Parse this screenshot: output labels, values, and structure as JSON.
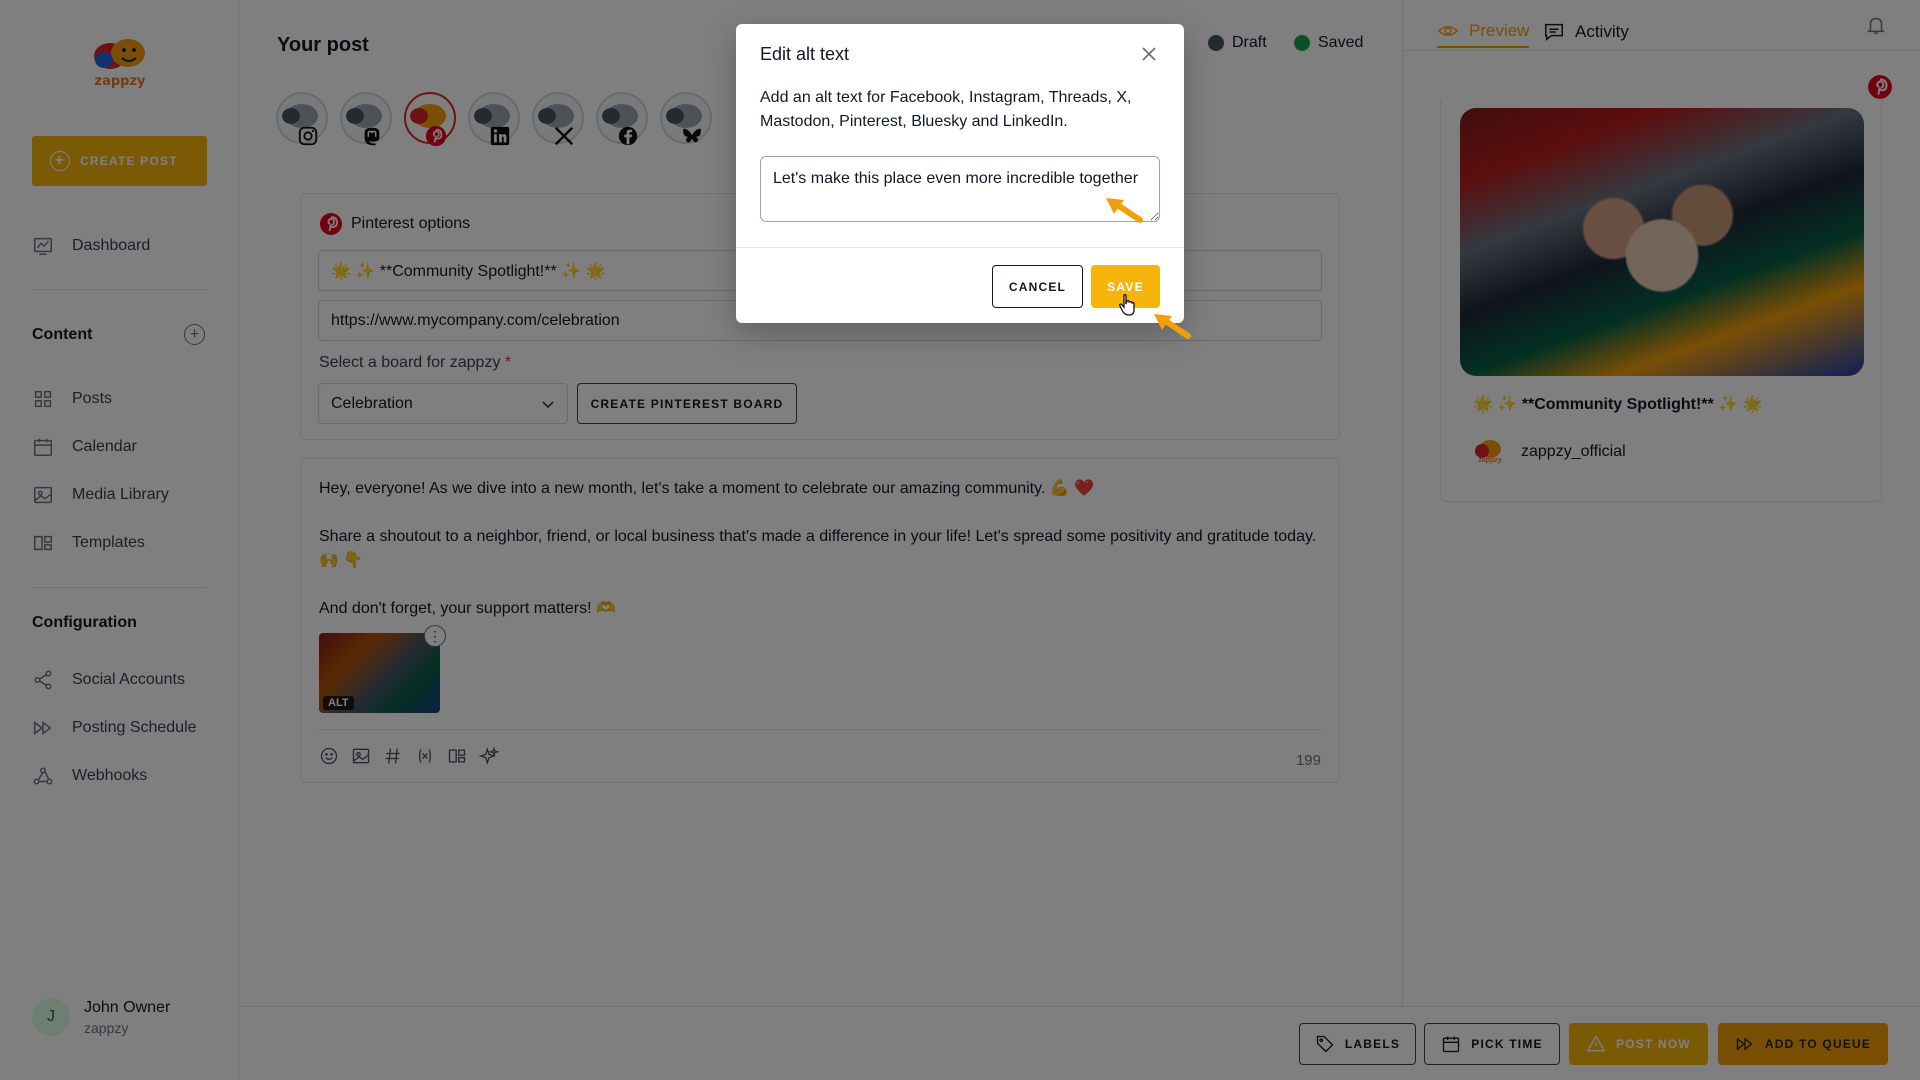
{
  "sidebar": {
    "logo_text": "zappzy",
    "create_post": "CREATE POST",
    "dashboard": "Dashboard",
    "content_title": "Content",
    "content_items": [
      "Posts",
      "Calendar",
      "Media Library",
      "Templates"
    ],
    "config_title": "Configuration",
    "config_items": [
      "Social Accounts",
      "Posting Schedule",
      "Webhooks"
    ],
    "user": {
      "initial": "J",
      "name": "John Owner",
      "org": "zappzy"
    }
  },
  "main": {
    "title": "Your post",
    "status_draft": "Draft",
    "status_saved": "Saved",
    "pinterest": {
      "header": "Pinterest options",
      "title_value": "🌟 ✨ **Community Spotlight!** ✨ 🌟",
      "link_value": "https://www.mycompany.com/celebration",
      "board_label": "Select a board for zappzy",
      "board_required": "*",
      "board_value": "Celebration",
      "create_board": "CREATE PINTEREST BOARD"
    },
    "body": {
      "paragraphs": [
        "Hey, everyone! As we dive into a new month, let's take a moment to celebrate our amazing community. 💪 ❤️",
        "Share a shoutout to a neighbor, friend, or local business that's made a difference in your life! Let's spread some positivity and gratitude today. 🙌 👇",
        "And don't forget, your support matters! 🫶"
      ],
      "alt_badge": "ALT",
      "char_count": "199"
    }
  },
  "bottom": {
    "labels": "LABELS",
    "pick_time": "PICK TIME",
    "post_now": "POST NOW",
    "add_to_queue": "ADD TO QUEUE"
  },
  "right": {
    "tab_preview": "Preview",
    "tab_activity": "Activity",
    "preview_title": "🌟 ✨ **Community Spotlight!** ✨ 🌟",
    "username": "zappzy_official"
  },
  "modal": {
    "title": "Edit alt text",
    "description": "Add an alt text for Facebook, Instagram, Threads, X, Mastodon, Pinterest, Bluesky and LinkedIn.",
    "input_value": "Let's make this place even more incredible together",
    "cancel": "CANCEL",
    "save": "SAVE"
  },
  "colors": {
    "accent": "#f5b50a",
    "draft_dot": "#4b5563",
    "saved_dot": "#16a34a",
    "pinterest": "#e60023"
  }
}
